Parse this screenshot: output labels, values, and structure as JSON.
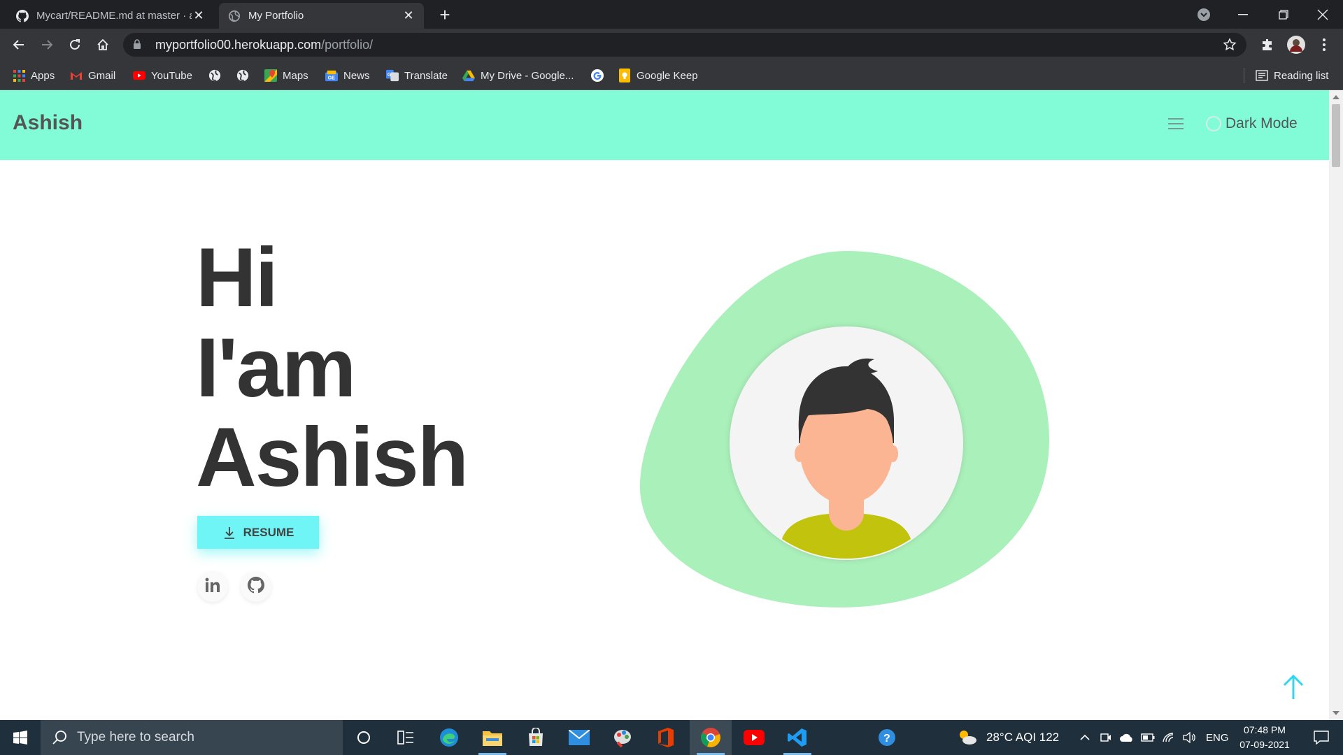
{
  "browser": {
    "tabs": [
      {
        "title": "Mycart/README.md at master · a",
        "icon": "github-icon",
        "active": false
      },
      {
        "title": "My Portfolio",
        "icon": "globe-icon",
        "active": true
      }
    ],
    "address": {
      "host": "myportfolio00.herokuapp.com",
      "path": "/portfolio/"
    },
    "bookmarks": [
      {
        "label": "Apps",
        "icon": "apps-grid-icon"
      },
      {
        "label": "Gmail",
        "icon": "gmail-icon"
      },
      {
        "label": "YouTube",
        "icon": "youtube-icon"
      },
      {
        "label": "",
        "icon": "globe-icon"
      },
      {
        "label": "",
        "icon": "globe-icon"
      },
      {
        "label": "Maps",
        "icon": "maps-icon"
      },
      {
        "label": "News",
        "icon": "news-icon"
      },
      {
        "label": "Translate",
        "icon": "translate-icon"
      },
      {
        "label": "My Drive - Google...",
        "icon": "drive-icon"
      },
      {
        "label": "",
        "icon": "google-icon"
      },
      {
        "label": "Google Keep",
        "icon": "keep-icon"
      }
    ],
    "reading_list": "Reading list"
  },
  "site": {
    "brand": "Ashish",
    "dark_mode_label": "Dark Mode",
    "hero_lines": [
      "Hi",
      "I'am",
      "Ashish"
    ],
    "resume_label": "RESUME",
    "social": [
      "linkedin-icon",
      "github-icon"
    ],
    "colors": {
      "header": "#81fcd7",
      "blob": "#aaf0bb",
      "button": "#6ff5f5",
      "shirt": "#c2c30c",
      "skin": "#fcb592",
      "hair": "#333333"
    }
  },
  "taskbar": {
    "search_placeholder": "Type here to search",
    "weather": "28°C  AQI 122",
    "language": "ENG",
    "time": "07:48 PM",
    "date": "07-09-2021"
  }
}
